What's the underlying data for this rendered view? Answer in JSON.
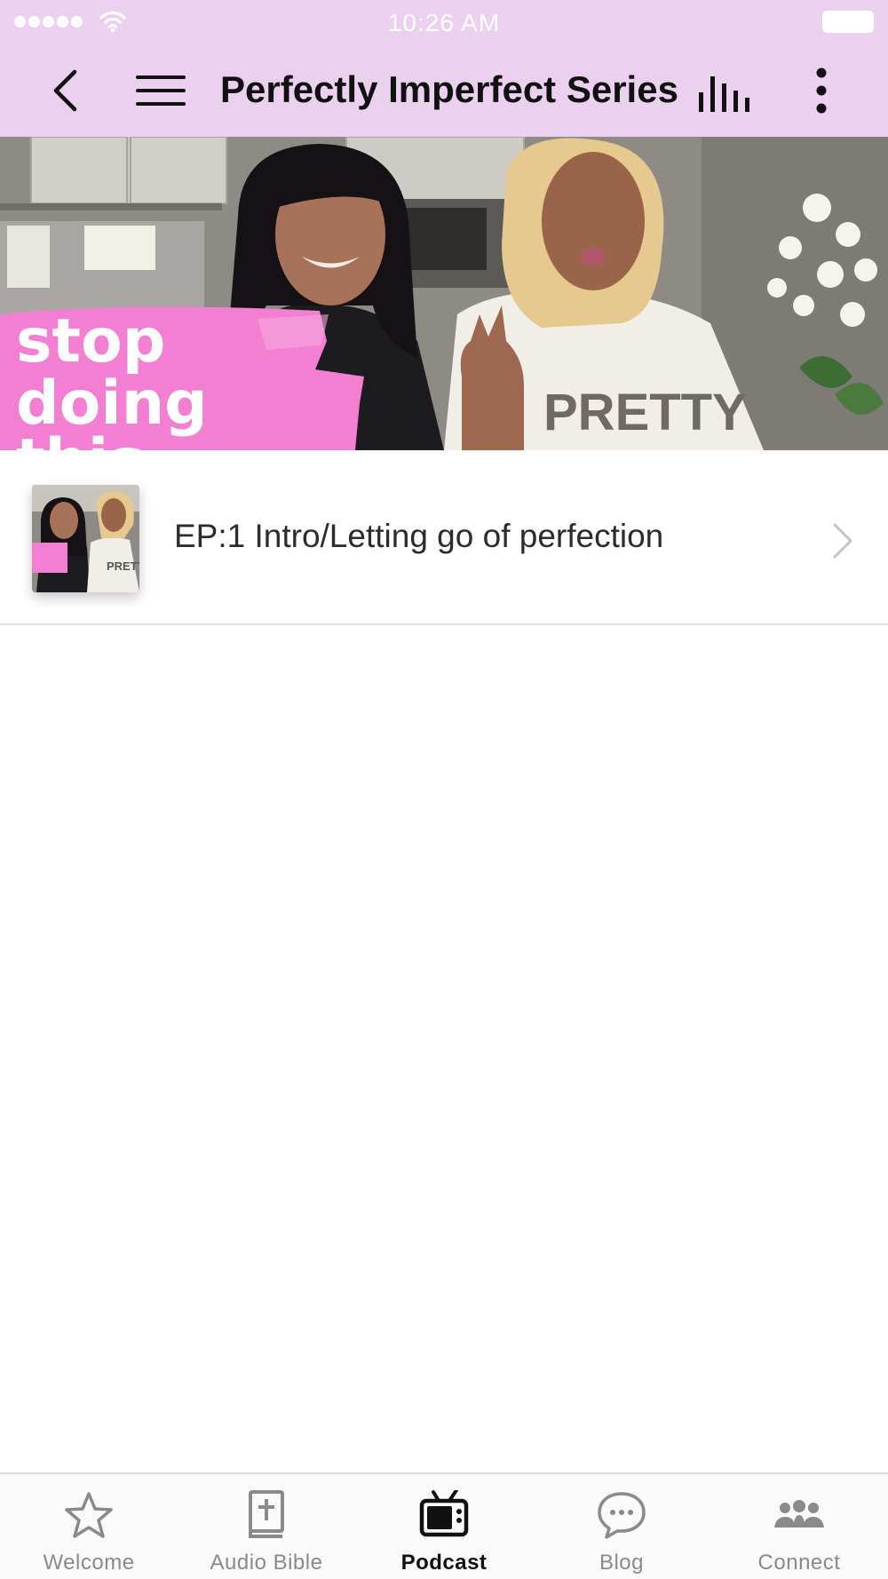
{
  "status_bar": {
    "time": "10:26 AM"
  },
  "nav": {
    "title": "Perfectly Imperfect Series"
  },
  "hero": {
    "overlay_text": [
      "stop",
      "doing",
      "this"
    ],
    "shirt_text": "PRETTY"
  },
  "episodes": [
    {
      "title": "EP:1 Intro/Letting go of perfection"
    }
  ],
  "tabs": [
    {
      "label": "Welcome",
      "icon": "star-icon",
      "active": false
    },
    {
      "label": "Audio Bible",
      "icon": "bible-icon",
      "active": false
    },
    {
      "label": "Podcast",
      "icon": "tv-icon",
      "active": true
    },
    {
      "label": "Blog",
      "icon": "chat-bubble-icon",
      "active": false
    },
    {
      "label": "Connect",
      "icon": "group-icon",
      "active": false
    }
  ],
  "colors": {
    "header_bg": "#ecd0ef",
    "accent_pink": "#f27fd1",
    "tab_inactive": "#8a8a8a",
    "tab_active": "#111111"
  }
}
